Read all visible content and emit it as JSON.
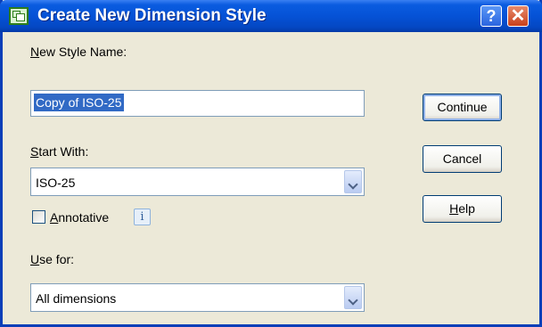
{
  "window": {
    "title": "Create New Dimension Style"
  },
  "titlebar": {
    "help_glyph": "?",
    "close_glyph": "✕"
  },
  "form": {
    "style_name": {
      "label_mnemonic": "N",
      "label_rest": "ew Style Name:",
      "value": "Copy of ISO-25"
    },
    "start_with": {
      "label_mnemonic": "S",
      "label_rest": "tart With:",
      "value": "ISO-25"
    },
    "annotative": {
      "label_mnemonic": "A",
      "label_rest": "nnotative",
      "checked": false,
      "info_glyph": "i"
    },
    "use_for": {
      "label_mnemonic": "U",
      "label_rest": "se for:",
      "value": "All dimensions"
    }
  },
  "buttons": {
    "continue": "Continue",
    "cancel": "Cancel",
    "help_mnemonic": "H",
    "help_rest": "elp"
  },
  "icons": {
    "app": "dimension-style-icon",
    "info": "info-icon",
    "dropdown": "chevron-down-icon"
  },
  "colors": {
    "titlebar": "#0552d6",
    "selection": "#316ac5",
    "dialog_bg": "#ece9d8"
  }
}
